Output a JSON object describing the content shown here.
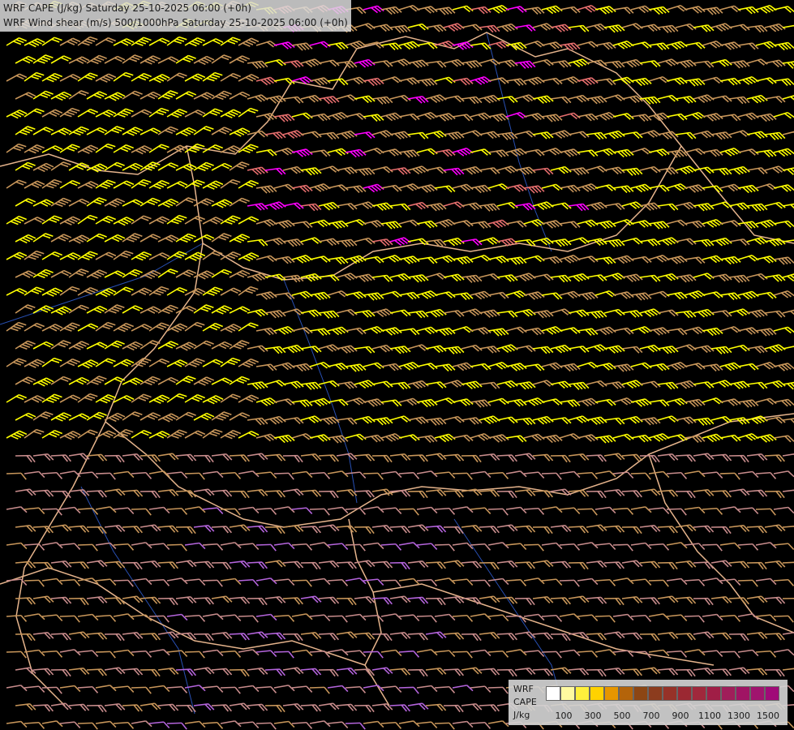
{
  "header": {
    "line1": "WRF CAPE (J/kg) Saturday 25-10-2025 06:00 (+0h)",
    "line2": "WRF Wind shear (m/s) 500/1000hPa Saturday 25-10-2025 06:00 (+0h)"
  },
  "legend": {
    "label_line1": "WRF",
    "label_line2": "CAPE",
    "label_line3": "J/kg",
    "colors": [
      "#ffffff",
      "#fffaa0",
      "#fff03c",
      "#ffd200",
      "#e69600",
      "#b4640a",
      "#8c4614",
      "#8c3c1e",
      "#963228",
      "#9b2832",
      "#a0283c",
      "#a01e46",
      "#a01e5a",
      "#a01464",
      "#a0146e",
      "#a00a78"
    ],
    "ticks": [
      "100",
      "300",
      "500",
      "700",
      "900",
      "1100",
      "1300",
      "1500"
    ]
  },
  "barb_colors": {
    "tan": "#c8965a",
    "yellow": "#ffff00",
    "pink": "#c88c8c",
    "salmon": "#e66e6e",
    "magenta": "#ff00ff",
    "violet": "#b464dc"
  },
  "map_colors": {
    "background": "#000000",
    "border": "#e6b48c",
    "river": "#2850b4",
    "coast": "#dcdcdc"
  }
}
